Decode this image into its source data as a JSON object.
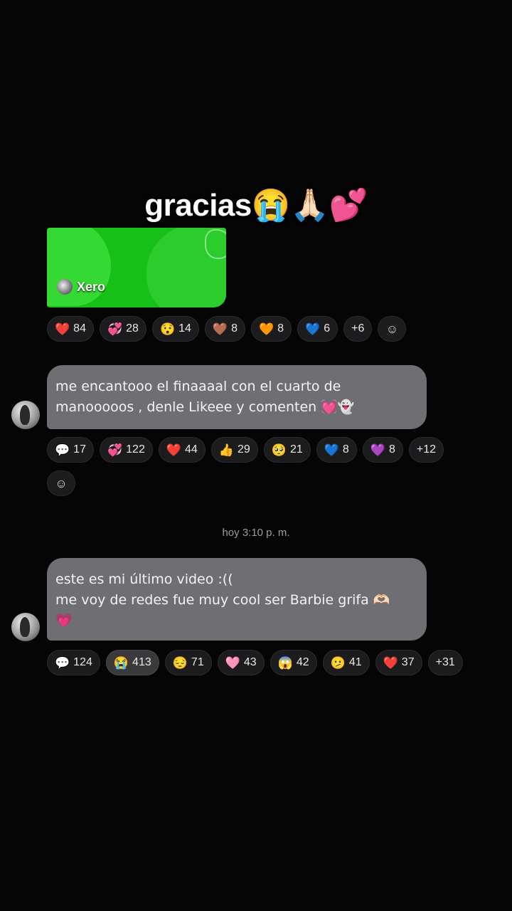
{
  "overlay": {
    "caption": "gracias😭🙏🏻💕"
  },
  "media": {
    "music_tag": "Xero",
    "icon": "music-disc-icon"
  },
  "reactions_row1": [
    {
      "emoji": "❤️",
      "count": "84"
    },
    {
      "emoji": "💞",
      "count": "28"
    },
    {
      "emoji": "😯",
      "count": "14"
    },
    {
      "emoji": "🤎",
      "count": "8"
    },
    {
      "emoji": "🧡",
      "count": "8"
    },
    {
      "emoji": "💙",
      "count": "6"
    },
    {
      "emoji": "",
      "count": "+6"
    }
  ],
  "add_reaction_icon": "☺",
  "message1": {
    "line1": "me encantooo el finaaaal con el cuarto de",
    "line2": "manooooos , denle Likeee y comenten 💓👻"
  },
  "reactions_row2": [
    {
      "emoji": "💬",
      "count": "17"
    },
    {
      "emoji": "💞",
      "count": "122"
    },
    {
      "emoji": "❤️",
      "count": "44"
    },
    {
      "emoji": "👍",
      "count": "29"
    },
    {
      "emoji": "🥺",
      "count": "21"
    },
    {
      "emoji": "💙",
      "count": "8"
    },
    {
      "emoji": "💜",
      "count": "8"
    },
    {
      "emoji": "",
      "count": "+12"
    }
  ],
  "timestamp": "hoy 3:10 p. m.",
  "message2": {
    "line1": "este es mi último video :((",
    "line2": "me voy de redes fue muy cool ser Barbie grifa 🫶🏻",
    "line3": "💗"
  },
  "reactions_row3": [
    {
      "emoji": "💬",
      "count": "124"
    },
    {
      "emoji": "😭",
      "count": "413"
    },
    {
      "emoji": "😔",
      "count": "71"
    },
    {
      "emoji": "🩷",
      "count": "43"
    },
    {
      "emoji": "😱",
      "count": "42"
    },
    {
      "emoji": "🫤",
      "count": "41"
    },
    {
      "emoji": "❤️",
      "count": "37"
    },
    {
      "emoji": "",
      "count": "+31"
    }
  ],
  "colors": {
    "background": "#050505",
    "bubble": "#6e6e73",
    "chip": "#1c1c1e",
    "media_green": "#2bcc2b"
  }
}
